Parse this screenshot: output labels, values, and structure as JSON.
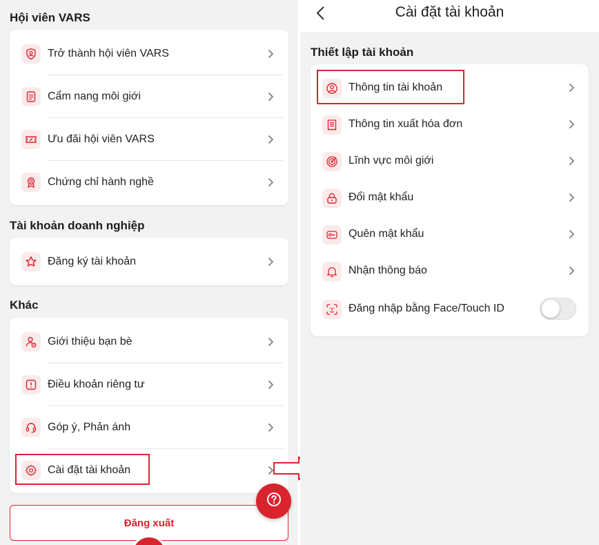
{
  "colors": {
    "accent": "#d9232e",
    "icon_bg": "#fbeaea",
    "background": "#f2f2f3"
  },
  "left": {
    "sections": [
      {
        "title": "Hội viên VARS",
        "items": [
          {
            "label": "Trở thành hội viên VARS",
            "icon": "shield-user-icon"
          },
          {
            "label": "Cẩm nang môi giới",
            "icon": "document-icon"
          },
          {
            "label": "Ưu đãi hội viên VARS",
            "icon": "ticket-icon"
          },
          {
            "label": "Chứng chỉ hành nghề",
            "icon": "badge-icon"
          }
        ]
      },
      {
        "title": "Tài khoản doanh nghiệp",
        "items": [
          {
            "label": "Đăng ký tài khoản",
            "icon": "star-icon"
          }
        ]
      },
      {
        "title": "Khác",
        "items": [
          {
            "label": "Giới thiệu bạn bè",
            "icon": "user-share-icon"
          },
          {
            "label": "Điều khoản riêng tư",
            "icon": "alert-icon"
          },
          {
            "label": "Góp ý, Phản ánh",
            "icon": "headset-icon"
          },
          {
            "label": "Cài đặt tài khoản",
            "icon": "gear-icon"
          }
        ]
      }
    ],
    "logout_label": "Đăng xuất"
  },
  "right": {
    "header_title": "Cài đặt tài khoản",
    "section_title": "Thiết lập tài khoản",
    "items": [
      {
        "label": "Thông tin tài khoản",
        "icon": "user-circle-icon"
      },
      {
        "label": "Thông tin xuất hóa đơn",
        "icon": "invoice-icon"
      },
      {
        "label": "Lĩnh vực môi giới",
        "icon": "target-icon"
      },
      {
        "label": "Đổi mật khẩu",
        "icon": "lock-icon"
      },
      {
        "label": "Quên mật khẩu",
        "icon": "key-icon"
      },
      {
        "label": "Nhận thông báo",
        "icon": "bell-icon"
      },
      {
        "label": "Đăng nhập bằng Face/Touch ID",
        "icon": "face-id-icon",
        "toggle": false
      }
    ]
  }
}
